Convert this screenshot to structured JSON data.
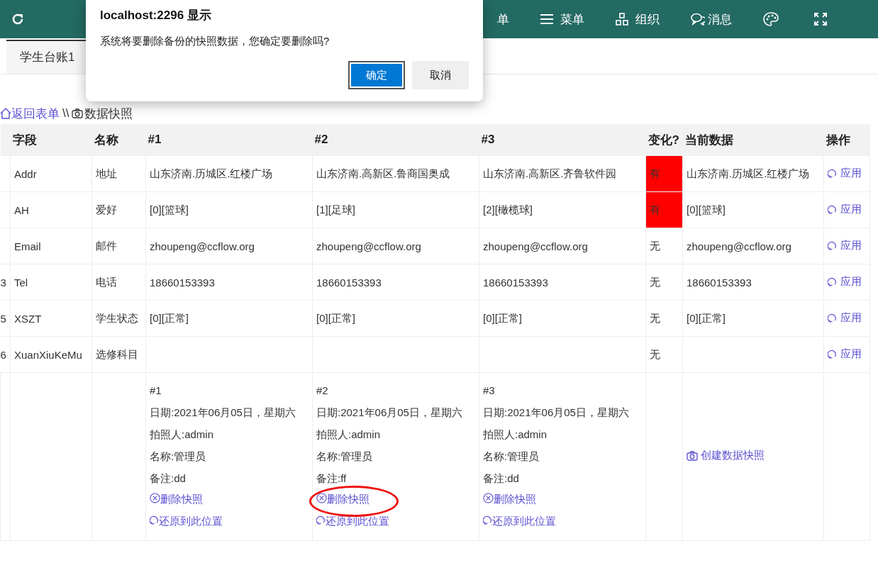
{
  "topbar": {
    "items": [
      {
        "kind": "text",
        "label": "单"
      },
      {
        "kind": "menu",
        "label": "菜单"
      },
      {
        "kind": "org",
        "label": "组织"
      },
      {
        "kind": "chat",
        "label": "消息"
      },
      {
        "kind": "palette"
      },
      {
        "kind": "fullscreen"
      }
    ]
  },
  "tabs": [
    {
      "label": "学生台账1",
      "selected": true
    }
  ],
  "breadcrumb": {
    "back": "返回表单",
    "separator": "\\\\",
    "current": "数据快照"
  },
  "table": {
    "columns": [
      "",
      "字段",
      "名称",
      "#1",
      "#2",
      "#3",
      "变化?",
      "当前数据",
      "操作"
    ],
    "rows": [
      {
        "field": "Addr",
        "name": "地址",
        "values": [
          "山东济南.历城区.红楼广场",
          "山东济南.高新区.鲁商国奥成",
          "山东济南.高新区.齐鲁软件园"
        ],
        "change": "有",
        "changed": true,
        "current": "山东济南.历城区.红楼广场",
        "action": "应用"
      },
      {
        "field": "AH",
        "name": "爱好",
        "values": [
          "[0][篮球]",
          "[1][足球]",
          "[2][橄榄球]"
        ],
        "change": "有",
        "changed": true,
        "current": "[0][篮球]",
        "action": "应用"
      },
      {
        "field": "Email",
        "name": "邮件",
        "values": [
          "zhoupeng@ccflow.org",
          "zhoupeng@ccflow.org",
          "zhoupeng@ccflow.org"
        ],
        "change": "无",
        "changed": false,
        "current": "zhoupeng@ccflow.org",
        "action": "应用"
      },
      {
        "index": "3",
        "field": "Tel",
        "name": "电话",
        "values": [
          "18660153393",
          "18660153393",
          "18660153393"
        ],
        "change": "无",
        "changed": false,
        "current": "18660153393",
        "action": "应用"
      },
      {
        "index": "5",
        "field": "XSZT",
        "name": "学生状态",
        "values": [
          "[0][正常]",
          "[0][正常]",
          "[0][正常]"
        ],
        "change": "无",
        "changed": false,
        "current": "[0][正常]",
        "action": "应用"
      },
      {
        "index": "6",
        "field": "XuanXiuKeMu",
        "name": "选修科目",
        "change": "无",
        "changed": false,
        "action": "应用"
      }
    ],
    "snapshots": [
      {
        "title": "#1",
        "lines": [
          "日期:2021年06月05日，星期六",
          "拍照人:admin",
          "名称:管理员",
          "备注:dd"
        ],
        "delete": "删除快照",
        "restore": "还原到此位置",
        "circled": false
      },
      {
        "title": "#2",
        "lines": [
          "日期:2021年06月05日，星期六",
          "拍照人:admin",
          "名称:管理员",
          "备注:ff"
        ],
        "delete": "删除快照",
        "restore": "还原到此位置",
        "circled": true
      },
      {
        "title": "#3",
        "lines": [
          "日期:2021年06月05日，星期六",
          "拍照人:admin",
          "名称:管理员",
          "备注:dd"
        ],
        "delete": "删除快照",
        "restore": "还原到此位置",
        "circled": false
      }
    ],
    "create": "创建数据快照"
  },
  "dialog": {
    "title": "localhost:2296 显示",
    "message": "系统将要删除备份的快照数据，您确定要删除吗?",
    "buttons": [
      {
        "label": "确定",
        "primary": true
      },
      {
        "label": "取消",
        "primary": false
      }
    ]
  }
}
